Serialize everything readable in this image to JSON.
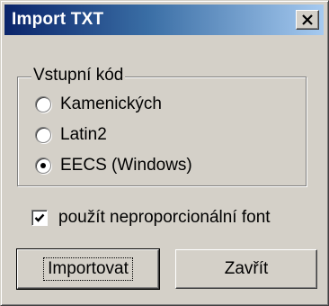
{
  "window": {
    "title": "Import TXT"
  },
  "group": {
    "legend": "Vstupní kód",
    "options": [
      {
        "label": "Kamenických",
        "selected": false
      },
      {
        "label": "Latin2",
        "selected": false
      },
      {
        "label": "EECS (Windows)",
        "selected": true
      }
    ]
  },
  "checkbox": {
    "label": "použít neproporcionální font",
    "checked": true
  },
  "buttons": {
    "import_label": "Importovat",
    "close_label": "Zavřít"
  },
  "icons": {
    "close": "close-icon",
    "check": "checkmark-icon"
  },
  "colors": {
    "titlebar_start": "#0a246a",
    "titlebar_end": "#a6caf0",
    "face": "#d4d0c8"
  }
}
